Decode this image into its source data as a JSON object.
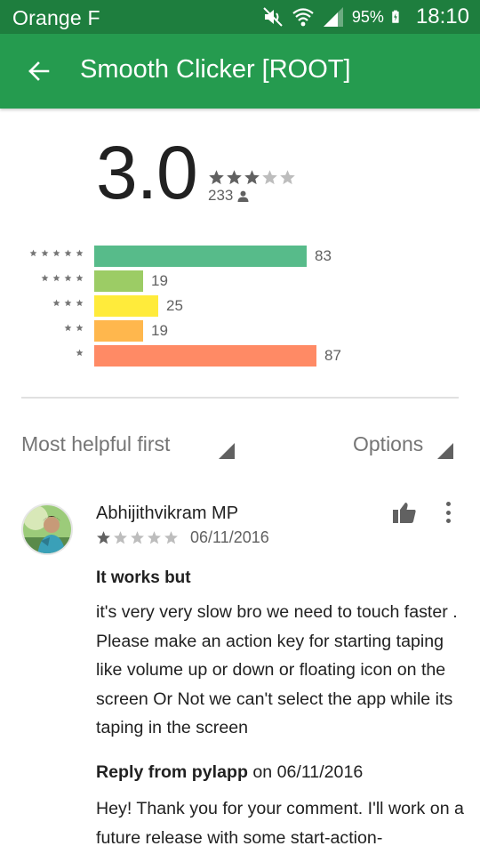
{
  "status_bar": {
    "carrier": "Orange F",
    "battery": "95%",
    "time": "18:10",
    "icons": [
      "mute-icon",
      "wifi-icon",
      "signal-icon",
      "battery-charging-icon"
    ]
  },
  "app_bar": {
    "title": "Smooth Clicker [ROOT]",
    "back_icon": "arrow-back-icon"
  },
  "rating": {
    "average": "3.0",
    "stars_filled": 3,
    "stars_total": 5,
    "count": "233",
    "count_icon": "person-icon"
  },
  "histogram": [
    {
      "stars": 5,
      "count": "83",
      "value": 83,
      "color": "#57bb8a"
    },
    {
      "stars": 4,
      "count": "19",
      "value": 19,
      "color": "#9ccc65"
    },
    {
      "stars": 3,
      "count": "25",
      "value": 25,
      "color": "#ffeb3b"
    },
    {
      "stars": 2,
      "count": "19",
      "value": 19,
      "color": "#ffb74d"
    },
    {
      "stars": 1,
      "count": "87",
      "value": 87,
      "color": "#ff8a65"
    }
  ],
  "sort": {
    "label": "Most helpful first",
    "options_label": "Options"
  },
  "review": {
    "author": "Abhijithvikram MP",
    "stars_filled": 1,
    "date": "06/11/2016",
    "title": "It works but",
    "body": "it's very very slow bro we need to touch faster . Please make an action key for starting taping like volume up or down or floating icon on the screen Or Not we can't select the app while its taping in the screen",
    "reply": {
      "from_label": "Reply from pylapp",
      "on_date": "on 06/11/2016",
      "body": "Hey! Thank you for your comment. I'll work on a future release with some start-action-"
    }
  },
  "colors": {
    "status_bar": "#1e7e3e",
    "app_bar": "#259b4f",
    "star_filled": "#616161",
    "star_empty": "#bdbdbd"
  }
}
